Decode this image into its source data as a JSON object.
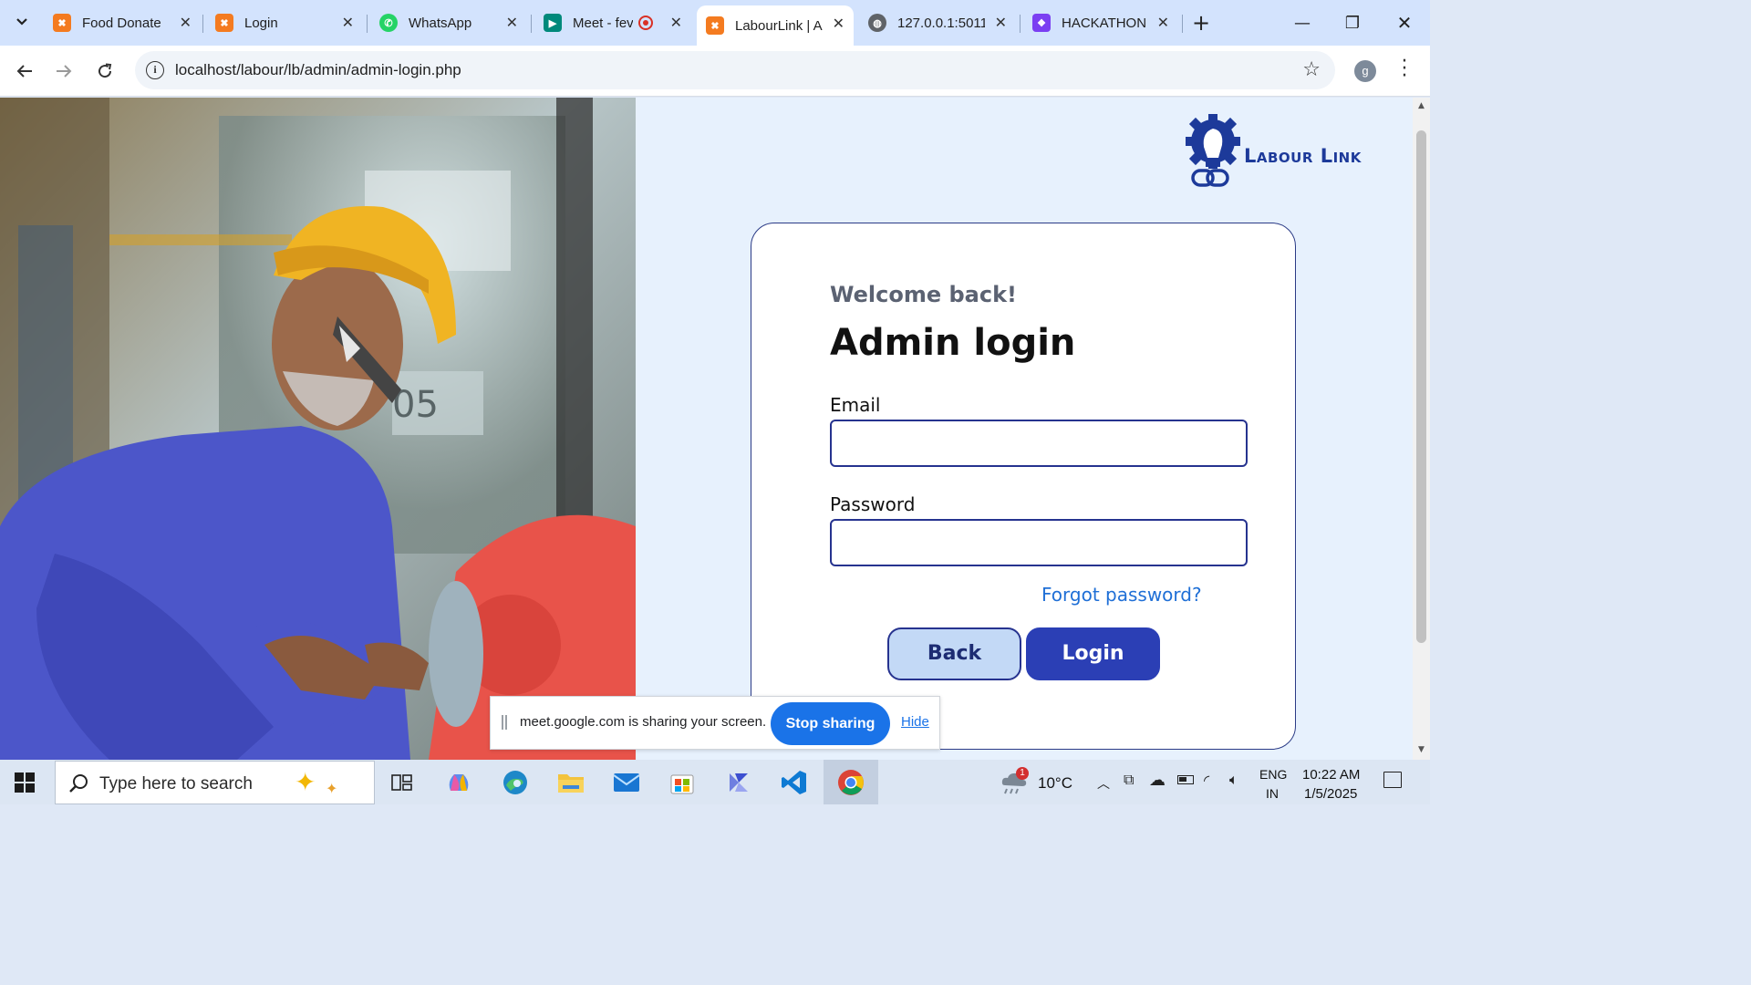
{
  "browser": {
    "tabs": [
      {
        "title": "Food Donate",
        "favicon": "xampp-icon",
        "color": "#f47b20"
      },
      {
        "title": "Login",
        "favicon": "xampp-icon",
        "color": "#f47b20"
      },
      {
        "title": "WhatsApp",
        "favicon": "whatsapp-icon",
        "color": "#25d366"
      },
      {
        "title": "Meet - fev",
        "favicon": "meet-icon",
        "color": "#00897b"
      },
      {
        "title": "LabourLink | A",
        "favicon": "xampp-icon",
        "color": "#f47b20",
        "active": true
      },
      {
        "title": "127.0.0.1:5011",
        "favicon": "globe-icon",
        "color": "#5f6368"
      },
      {
        "title": "HACKATHON",
        "favicon": "devfolio-icon",
        "color": "#7b3ff2"
      }
    ],
    "url": "localhost/labour/lb/admin/admin-login.php",
    "profile_initial": "g"
  },
  "page": {
    "logo_text": "Labour Link",
    "welcome": "Welcome back!",
    "title": "Admin login",
    "email_label": "Email",
    "email_value": "",
    "password_label": "Password",
    "password_value": "",
    "forgot": "Forgot password?",
    "back_button": "Back",
    "login_button": "Login",
    "colors": {
      "primary": "#2b3fb5",
      "border": "#26338f",
      "back_bg": "#c3d9f6",
      "link": "#1f6fd6",
      "page_bg": "#e7f1fd"
    }
  },
  "share_banner": {
    "text": "meet.google.com is sharing your screen.",
    "stop": "Stop sharing",
    "hide": "Hide"
  },
  "taskbar": {
    "search_placeholder": "Type here to search",
    "weather_temp": "10°C",
    "weather_badge": "1",
    "lang_top": "ENG",
    "lang_bottom": "IN",
    "time": "10:22 AM",
    "date": "1/5/2025"
  }
}
